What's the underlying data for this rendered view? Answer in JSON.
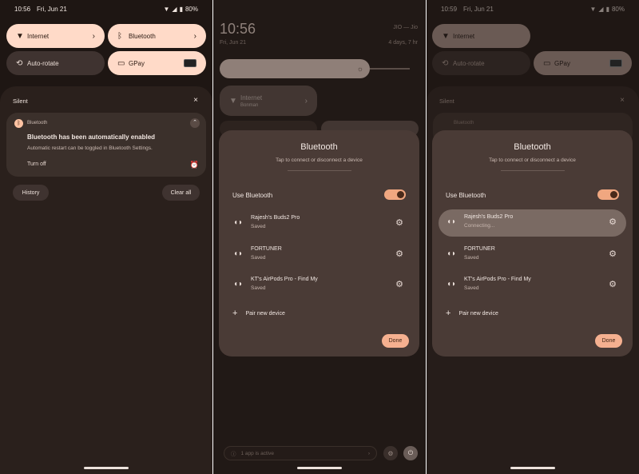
{
  "panel1": {
    "status": {
      "time": "10:56",
      "date": "Fri, Jun 21",
      "battery": "80%"
    },
    "tiles": [
      {
        "label": "Internet",
        "icon": "wifi-icon"
      },
      {
        "label": "Bluetooth",
        "icon": "bluetooth-icon"
      },
      {
        "label": "Auto-rotate",
        "icon": "rotate-icon"
      },
      {
        "label": "GPay",
        "icon": "wallet-icon"
      }
    ],
    "section": "Silent",
    "close": "×",
    "notification": {
      "app": "Bluetooth",
      "title": "Bluetooth has been automatically enabled",
      "body": "Automatic restart can be toggled in Bluetooth Settings.",
      "action": "Turn off"
    },
    "history": "History",
    "clear_all": "Clear all"
  },
  "panel2": {
    "clock": "10:56",
    "date": "Fri, Jun 21",
    "status_right": "4 days, 7 hr",
    "carrier": "JIO — Jio",
    "internet_tile": {
      "label": "Internet",
      "sub": "Bonman"
    },
    "active_apps": "1 app is active"
  },
  "panel3": {
    "status": {
      "time": "10:59",
      "date": "Fri, Jun 21",
      "battery": "80%"
    },
    "tiles": [
      {
        "label": "Internet"
      },
      {
        "label": "Auto-rotate"
      },
      {
        "label": "GPay"
      }
    ],
    "section": "Silent",
    "app": "Bluetooth"
  },
  "dialog": {
    "title": "Bluetooth",
    "subtitle": "Tap to connect or disconnect a device",
    "use_label": "Use Bluetooth",
    "devices": [
      {
        "name": "Rajesh's Buds2 Pro",
        "state": "Saved"
      },
      {
        "name": "FORTUNER",
        "state": "Saved"
      },
      {
        "name": "KT's AirPods Pro - Find My",
        "state": "Saved"
      }
    ],
    "devices_connecting": [
      {
        "name": "Rajesh's Buds2 Pro",
        "state": "Connecting..."
      },
      {
        "name": "FORTUNER",
        "state": "Saved"
      },
      {
        "name": "KT's AirPods Pro - Find My",
        "state": "Saved"
      }
    ],
    "pair_new": "Pair new device",
    "done": "Done"
  },
  "colors": {
    "accent": "#ffdac8",
    "toggle": "#f0a780",
    "dialog": "#4a3b36",
    "background": "#1e1613"
  }
}
